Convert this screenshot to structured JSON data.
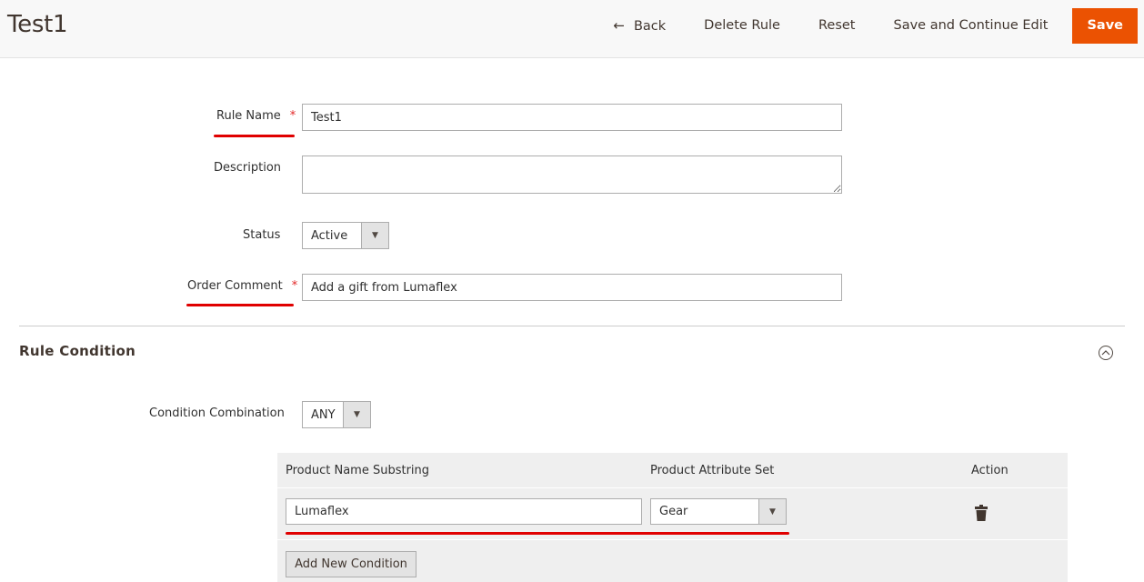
{
  "header": {
    "title": "Test1",
    "actions": {
      "back": "Back",
      "delete": "Delete Rule",
      "reset": "Reset",
      "save_continue": "Save and Continue Edit",
      "save": "Save"
    },
    "back_icon": "←"
  },
  "form": {
    "rule_name": {
      "label": "Rule Name",
      "required_mark": "*",
      "value": "Test1"
    },
    "description": {
      "label": "Description",
      "value": ""
    },
    "status": {
      "label": "Status",
      "value": "Active"
    },
    "order_comment": {
      "label": "Order Comment",
      "required_mark": "*",
      "value": "Add a gift from Lumaflex"
    }
  },
  "rule_condition": {
    "title": "Rule Condition",
    "combination": {
      "label": "Condition Combination",
      "value": "ANY"
    },
    "grid": {
      "columns": [
        "Product Name Substring",
        "Product Attribute Set",
        "Action"
      ],
      "rows": [
        {
          "name_substring": "Lumaflex",
          "attribute_set": "Gear"
        }
      ],
      "add_button": "Add New Condition"
    }
  },
  "colors": {
    "accent": "#eb5202",
    "annotation": "#e00000"
  },
  "caret": "▼"
}
